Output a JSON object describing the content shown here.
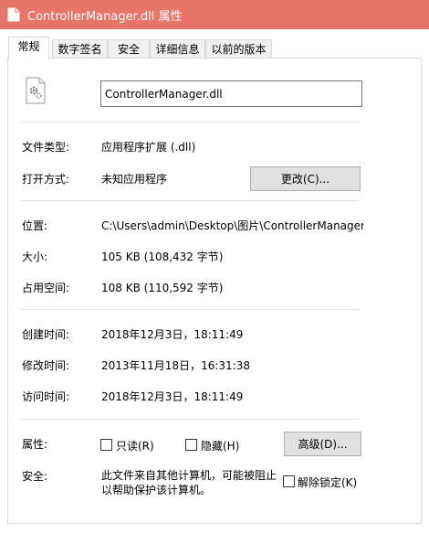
{
  "window": {
    "title": "ControllerManager.dll 属性"
  },
  "tabs": [
    {
      "label": "常规",
      "active": true
    },
    {
      "label": "数字签名"
    },
    {
      "label": "安全"
    },
    {
      "label": "详细信息"
    },
    {
      "label": "以前的版本"
    }
  ],
  "file": {
    "name": "ControllerManager.dll",
    "icon": "dll-gear-file-icon"
  },
  "info": {
    "type_label": "文件类型:",
    "type_value": "应用程序扩展 (.dll)",
    "open_label": "打开方式:",
    "open_value": "未知应用程序",
    "change_button": "更改(C)...",
    "location_label": "位置:",
    "location_value": "C:\\Users\\admin\\Desktop\\图片\\ControllerManager",
    "size_label": "大小:",
    "size_value": "105 KB (108,432 字节)",
    "disk_label": "占用空间:",
    "disk_value": "108 KB (110,592 字节)",
    "created_label": "创建时间:",
    "created_value": "2018年12月3日，18:11:49",
    "modified_label": "修改时间:",
    "modified_value": "2013年11月18日，16:31:38",
    "accessed_label": "访问时间:",
    "accessed_value": "2018年12月3日，18:11:49"
  },
  "attributes": {
    "label": "属性:",
    "readonly": {
      "label": "只读(R)",
      "checked": false
    },
    "hidden": {
      "label": "隐藏(H)",
      "checked": false
    },
    "advanced_button": "高级(D)..."
  },
  "security": {
    "label": "安全:",
    "message_line1": "此文件来自其他计算机，可能被阻止",
    "message_line2": "以帮助保护该计算机。",
    "unblock": {
      "label": "解除锁定(K)",
      "checked": false
    }
  },
  "colors": {
    "titlebar": "#e8756a",
    "button_bg": "#e1e1e1",
    "separator": "#e3e3e3"
  }
}
